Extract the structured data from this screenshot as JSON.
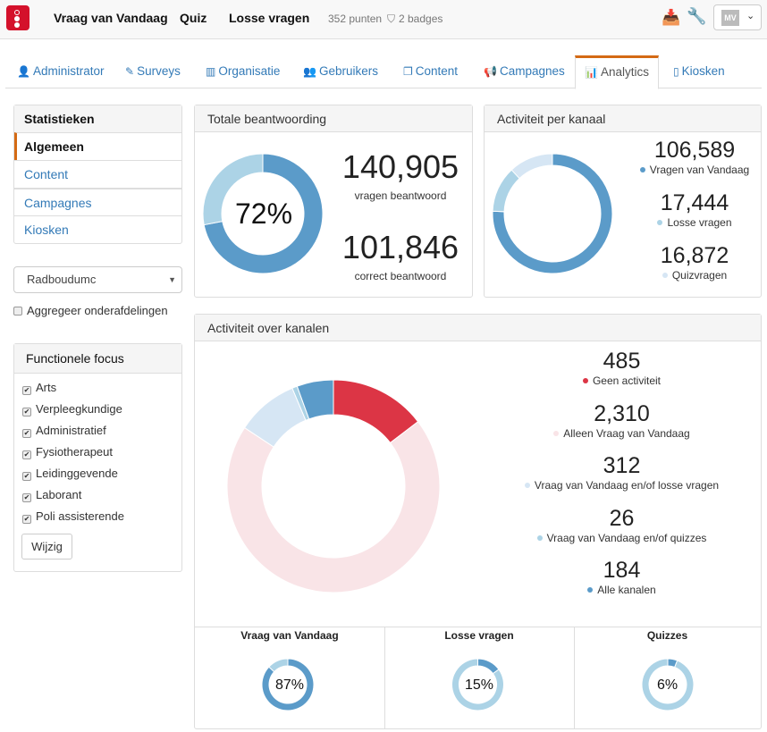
{
  "header": {
    "nav": [
      "Vraag van Vandaag",
      "Quiz",
      "Losse vragen"
    ],
    "points": "352 punten",
    "badges": "2 badges",
    "user_initials": "MV"
  },
  "tabs": [
    {
      "label": "Administrator",
      "icon": "user-icon"
    },
    {
      "label": "Surveys",
      "icon": "pencil-icon"
    },
    {
      "label": "Organisatie",
      "icon": "building-icon"
    },
    {
      "label": "Gebruikers",
      "icon": "users-icon"
    },
    {
      "label": "Content",
      "icon": "copy-icon"
    },
    {
      "label": "Campagnes",
      "icon": "megaphone-icon"
    },
    {
      "label": "Analytics",
      "icon": "bar-chart-icon",
      "active": true
    },
    {
      "label": "Kiosken",
      "icon": "tablet-icon"
    }
  ],
  "sidebar": {
    "title": "Statistieken",
    "items": [
      "Algemeen",
      "Content",
      "Campagnes",
      "Kiosken"
    ],
    "active": "Algemeen",
    "org_select": "Radboudumc",
    "aggregate_label": "Aggregeer onderafdelingen",
    "aggregate_checked": false,
    "focus": {
      "title": "Functionele focus",
      "items": [
        "Arts",
        "Verpleegkundige",
        "Administratief",
        "Fysiotherapeut",
        "Leidinggevende",
        "Laborant",
        "Poli assisterende"
      ],
      "button": "Wijzig"
    }
  },
  "colors": {
    "blue": "#5b9bc9",
    "light": "#acd3e6",
    "pale": "#d6e6f4",
    "red": "#dc3545",
    "pink": "#f9e4e7"
  },
  "total": {
    "title": "Totale beantwoording",
    "percent": "72%",
    "answered": "140,905",
    "answered_label": "vragen beantwoord",
    "correct": "101,846",
    "correct_label": "correct beantwoord"
  },
  "channel": {
    "title": "Activiteit per kanaal",
    "items": [
      {
        "value": "106,589",
        "label": "Vragen van Vandaag",
        "color": "#5b9bc9"
      },
      {
        "value": "17,444",
        "label": "Losse vragen",
        "color": "#acd3e6"
      },
      {
        "value": "16,872",
        "label": "Quizvragen",
        "color": "#d6e6f4"
      }
    ]
  },
  "across": {
    "title": "Activiteit over kanalen",
    "items": [
      {
        "value": "485",
        "label": "Geen activiteit",
        "color": "#dc3545"
      },
      {
        "value": "2,310",
        "label": "Alleen Vraag van Vandaag",
        "color": "#f9e4e7"
      },
      {
        "value": "312",
        "label": "Vraag van Vandaag en/of losse vragen",
        "color": "#d6e6f4"
      },
      {
        "value": "26",
        "label": "Vraag van Vandaag en/of quizzes",
        "color": "#acd3e6"
      },
      {
        "value": "184",
        "label": "Alle kanalen",
        "color": "#5b9bc9"
      }
    ]
  },
  "mini": [
    {
      "title": "Vraag van Vandaag",
      "percent": "87%",
      "fraction": 0.87
    },
    {
      "title": "Losse vragen",
      "percent": "15%",
      "fraction": 0.15
    },
    {
      "title": "Quizzes",
      "percent": "6%",
      "fraction": 0.06
    }
  ]
}
